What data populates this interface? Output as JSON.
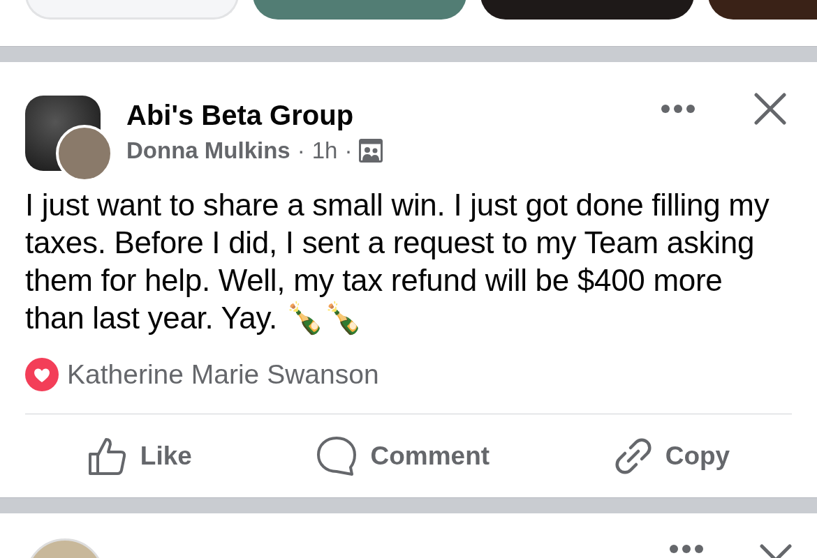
{
  "post": {
    "group": "Abi's Beta Group",
    "author": "Donna Mulkins",
    "separator_1": "·",
    "time": "1h",
    "separator_2": "·",
    "text": "I just want to share a small win. I just got done filling my taxes. Before I did, I sent a request to my Team asking them for help. Well, my tax refund will be $400 more than last year. Yay.  🍾🍾",
    "reaction": {
      "name": "Katherine Marie Swanson"
    },
    "actions": [
      {
        "kind": "like",
        "label": "Like"
      },
      {
        "kind": "comment",
        "label": "Comment"
      },
      {
        "kind": "copy",
        "label": "Copy"
      }
    ]
  }
}
